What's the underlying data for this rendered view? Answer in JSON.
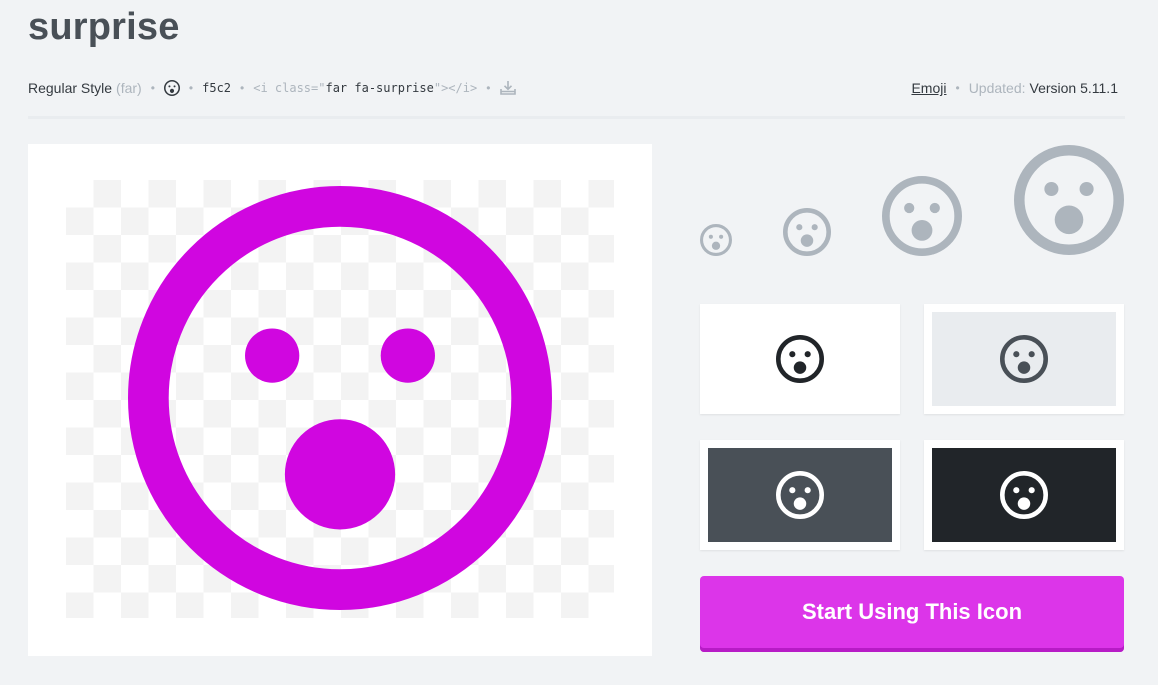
{
  "page": {
    "title": "surprise"
  },
  "meta": {
    "style_label": "Regular Style",
    "style_prefix": "(far)",
    "unicode": "f5c2",
    "code_open": "<i class=\"",
    "code_class": "far fa-surprise",
    "code_close": "\"></i>",
    "category": "Emoji",
    "updated_label": "Updated:",
    "version": "Version 5.11.1"
  },
  "colors": {
    "accent": "#d006e0",
    "size_gray": "#adb5bd",
    "bg_white": "#ffffff",
    "bg_light": "#e9ecef",
    "bg_dark": "#495057",
    "bg_darker": "#212529",
    "cta": "#dc35e9"
  },
  "icons": {
    "preview": "surprise-icon",
    "download": "download-icon"
  },
  "cta": {
    "label": "Start Using This Icon"
  }
}
